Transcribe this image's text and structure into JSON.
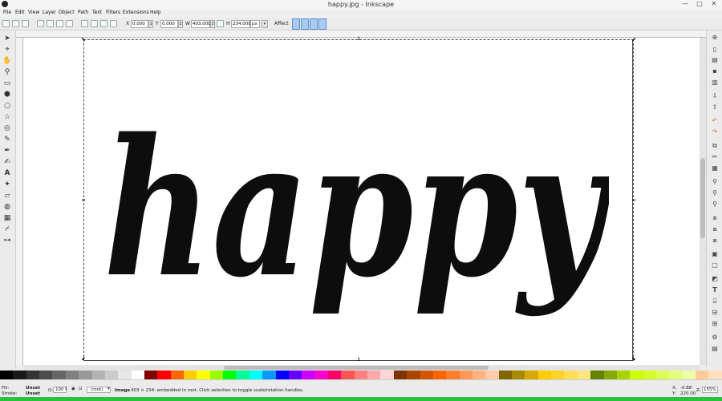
{
  "window": {
    "title": "happy.jpg - Inkscape",
    "minimize": "—",
    "maximize": "□",
    "close": "✕"
  },
  "menu": [
    "File",
    "Edit",
    "View",
    "Layer",
    "Object",
    "Path",
    "Text",
    "Filters",
    "Extensions",
    "Help"
  ],
  "toolcontrols": {
    "x_label": "X",
    "x_value": "0.000",
    "y_label": "Y",
    "y_value": "0.000",
    "w_label": "W",
    "w_value": "403.000",
    "h_label": "H",
    "h_value": "234.000",
    "unit": "px",
    "affect_label": "Affect"
  },
  "canvas": {
    "artwork_text": "happy"
  },
  "palette_colors": [
    "#000000",
    "#1a1a1a",
    "#333333",
    "#4d4d4d",
    "#666666",
    "#808080",
    "#999999",
    "#b3b3b3",
    "#cccccc",
    "#e6e6e6",
    "#ffffff",
    "#800000",
    "#ff0000",
    "#ff6600",
    "#ffcc00",
    "#ffff00",
    "#99ff00",
    "#00ff00",
    "#00ff99",
    "#00ffff",
    "#0099ff",
    "#0000ff",
    "#6600ff",
    "#cc00ff",
    "#ff00cc",
    "#ff0066",
    "#ff5555",
    "#ff8080",
    "#ffaaaa",
    "#ffd5d5",
    "#803300",
    "#aa4400",
    "#d45500",
    "#ff6600",
    "#ff7f2a",
    "#ff9955",
    "#ffb380",
    "#ffccaa",
    "#806600",
    "#aa8800",
    "#d4aa00",
    "#ffcc00",
    "#ffd42a",
    "#ffdd55",
    "#ffe680",
    "#668000",
    "#88aa00",
    "#aad400",
    "#ccff00",
    "#d4ff2a",
    "#ddff55",
    "#e5ff80",
    "#eeffaa",
    "#ffcc99",
    "#ffe0c0"
  ],
  "status": {
    "fill_label": "Fill:",
    "fill_value": "Unset",
    "stroke_label": "Stroke:",
    "stroke_value": "Unset",
    "opacity_label": "O:",
    "opacity_value": "100",
    "layer_value": "(root)",
    "message_bold": "Image",
    "message": " 403 × 234: embedded in root. Click selection to toggle scale/rotation handles.",
    "x_coord_label": "X:",
    "x_coord": "-0.88",
    "y_coord_label": "Y:",
    "y_coord": "220.00",
    "zoom_label": "Z:",
    "zoom_value": "155%"
  }
}
